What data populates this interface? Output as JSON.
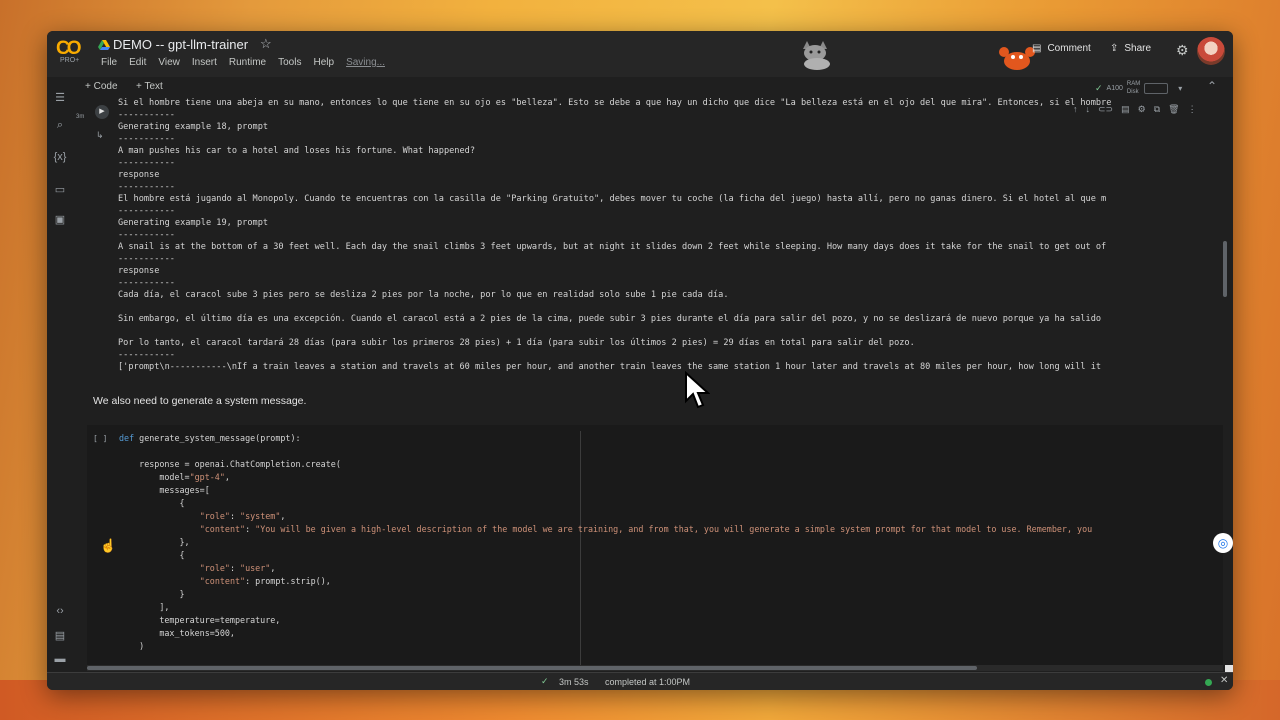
{
  "app": {
    "logo": "CO",
    "logo_sub": "PRO+",
    "title": "DEMO -- gpt-llm-trainer",
    "menu": [
      "File",
      "Edit",
      "View",
      "Insert",
      "Runtime",
      "Tools",
      "Help"
    ],
    "saving": "Saving...",
    "comment": "Comment",
    "share": "Share"
  },
  "toolbar": {
    "code": "+ Code",
    "text": "+ Text",
    "runtime": "A100",
    "ram": "RAM",
    "disk": "Disk"
  },
  "output_cell": {
    "run_time": "3m",
    "lines": [
      "Si el hombre tiene una abeja en su mano, entonces lo que tiene en su ojo es \"belleza\". Esto se debe a que hay un dicho que dice \"La belleza está en el ojo del que mira\". Entonces, si el hombre",
      "-----------",
      "Generating example 18, prompt",
      "-----------",
      "A man pushes his car to a hotel and loses his fortune. What happened?",
      "-----------",
      "response",
      "-----------",
      "El hombre está jugando al Monopoly. Cuando te encuentras con la casilla de \"Parking Gratuito\", debes mover tu coche (la ficha del juego) hasta allí, pero no ganas dinero. Si el hotel al que m",
      "-----------",
      "Generating example 19, prompt",
      "-----------",
      "A snail is at the bottom of a 30 feet well. Each day the snail climbs 3 feet upwards, but at night it slides down 2 feet while sleeping. How many days does it take for the snail to get out of",
      "-----------",
      "response",
      "-----------",
      "Cada día, el caracol sube 3 pies pero se desliza 2 pies por la noche, por lo que en realidad solo sube 1 pie cada día.",
      "",
      "Sin embargo, el último día es una excepción. Cuando el caracol está a 2 pies de la cima, puede subir 3 pies durante el día para salir del pozo, y no se deslizará de nuevo porque ya ha salido",
      "",
      "Por lo tanto, el caracol tardará 28 días (para subir los primeros 28 pies) + 1 día (para subir los últimos 2 pies) = 29 días en total para salir del pozo.",
      "-----------",
      "['prompt\\n-----------\\nIf a train leaves a station and travels at 60 miles per hour, and another train leaves the same station 1 hour later and travels at 80 miles per hour, how long will it"
    ]
  },
  "text_cell": "We also need to generate a system message.",
  "code_cell": {
    "bracket": "[ ]",
    "lines": [
      "def generate_system_message(prompt):",
      "",
      "    response = openai.ChatCompletion.create(",
      "        model=\"gpt-4\",",
      "        messages=[",
      "            {",
      "                \"role\": \"system\",",
      "                \"content\": \"You will be given a high-level description of the model we are training, and from that, you will generate a simple system prompt for that model to use. Remember, you",
      "            },",
      "            {",
      "                \"role\": \"user\",",
      "                \"content\": prompt.strip(),",
      "            }",
      "        ],",
      "        temperature=temperature,",
      "        max_tokens=500,",
      "    )"
    ]
  },
  "status": {
    "duration": "3m 53s",
    "completed": "completed at 1:00PM"
  }
}
